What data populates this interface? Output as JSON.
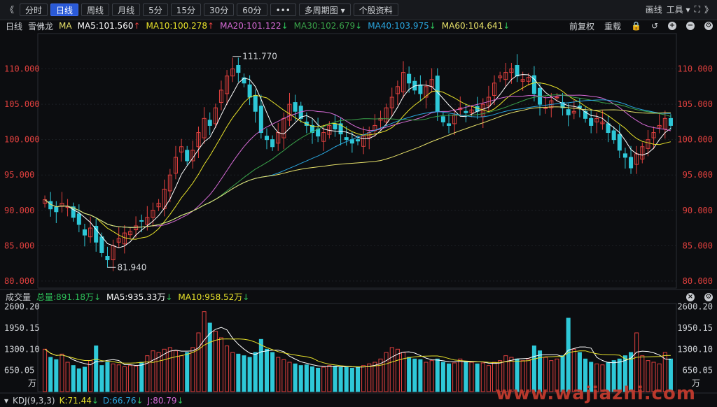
{
  "toolbar": {
    "back": "《",
    "periods": [
      "分时",
      "日线",
      "周线",
      "月线",
      "5分",
      "15分",
      "30分",
      "60分",
      "•••",
      "多周期图 ▾",
      "个股资料"
    ],
    "active_index": 1,
    "draw_label": "画线",
    "tools_label": "工具 ▾",
    "fullscreen": "⛶",
    "forward": "》"
  },
  "indicator": {
    "period": "日线",
    "stock_name": "雪佛龙",
    "ma_label": "MA",
    "ma5": "MA5:101.560",
    "ma10": "MA10:100.278",
    "ma20": "MA20:101.122",
    "ma30": "MA30:102.679",
    "ma40": "MA40:103.975",
    "ma60": "MA60:104.641",
    "ma5_dir": "↑",
    "ma10_dir": "↑",
    "ma20_dir": "↓",
    "ma30_dir": "↓",
    "ma40_dir": "↓",
    "ma60_dir": "↓",
    "adjust": "前复权",
    "redraw": "重载"
  },
  "colors": {
    "ma5": "#ffffff",
    "ma10": "#e8e22a",
    "ma20": "#d66bd6",
    "ma30": "#3aa34a",
    "ma40": "#2aa7e0",
    "ma60": "#e8e26a",
    "up": "#e0403e",
    "down": "#2ec8d8",
    "grid": "#2a2d33"
  },
  "price_axis": {
    "labels": [
      "110.000",
      "105.000",
      "100.000",
      "95.000",
      "90.000",
      "85.000",
      "80.000"
    ],
    "values": [
      110,
      105,
      100,
      95,
      90,
      85,
      80
    ],
    "high_label": "111.770",
    "low_label": "81.940"
  },
  "volume": {
    "title": "成交量",
    "total": "总量:891.18万",
    "ma5": "MA5:935.33万",
    "ma10": "MA10:958.52万",
    "total_dir": "↓",
    "ma5_dir": "↓",
    "ma10_dir": "↓",
    "axis_labels": [
      "2600.20",
      "1950.15",
      "1300.10",
      "650.05"
    ],
    "axis_values": [
      2600.2,
      1950.15,
      1300.1,
      650.05
    ],
    "unit": "万"
  },
  "kdj": {
    "name": "KDJ(9,3,3)",
    "k": "K:71.44",
    "d": "D:66.76",
    "j": "J:80.79",
    "k_dir": "↓",
    "d_dir": "↓",
    "j_dir": "↓"
  },
  "watermark": "www.wajiazhi.com",
  "chart_data": {
    "type": "candlestick",
    "ylim": [
      79,
      115
    ],
    "close": [
      91.5,
      90.2,
      89.8,
      91.0,
      90.5,
      89.0,
      88.0,
      86.5,
      87.5,
      85.5,
      84.0,
      83.0,
      85.0,
      86.0,
      86.8,
      87.0,
      87.8,
      88.5,
      89.0,
      90.0,
      91.0,
      93.0,
      95.0,
      97.5,
      99.0,
      97.0,
      98.5,
      101.0,
      103.0,
      102.0,
      104.5,
      107.0,
      109.0,
      110.0,
      109.5,
      108.0,
      106.0,
      104.0,
      101.0,
      100.0,
      99.0,
      101.0,
      103.0,
      105.0,
      104.0,
      103.0,
      102.0,
      101.0,
      100.5,
      101.0,
      102.0,
      101.5,
      100.8,
      100.0,
      99.5,
      99.8,
      100.5,
      101.0,
      102.0,
      103.0,
      104.5,
      106.0,
      107.5,
      109.5,
      108.0,
      107.0,
      106.5,
      107.5,
      108.5,
      104.0,
      102.5,
      102.0,
      103.5,
      104.5,
      103.8,
      104.2,
      104.0,
      105.0,
      106.0,
      108.0,
      109.0,
      109.5,
      110.0,
      109.0,
      108.5,
      108.8,
      106.5,
      105.0,
      104.5,
      105.5,
      106.0,
      104.5,
      103.5,
      104.0,
      104.5,
      103.0,
      102.0,
      103.0,
      102.5,
      101.0,
      100.0,
      98.5,
      97.5,
      96.0,
      98.0,
      99.0,
      100.0,
      101.0,
      102.0,
      103.0,
      102.0
    ],
    "volume": [
      1300,
      1050,
      980,
      1150,
      900,
      800,
      700,
      750,
      950,
      1400,
      800,
      900,
      850,
      820,
      760,
      800,
      780,
      900,
      1100,
      1250,
      1200,
      1300,
      1350,
      1250,
      1100,
      1200,
      1350,
      1800,
      2450,
      2100,
      1850,
      1650,
      1400,
      1200,
      1150,
      1100,
      1050,
      1200,
      1600,
      1300,
      1200,
      1050,
      980,
      900,
      850,
      800,
      820,
      760,
      720,
      750,
      800,
      780,
      760,
      740,
      720,
      760,
      800,
      850,
      900,
      1000,
      1200,
      1350,
      1300,
      1200,
      1050,
      1000,
      980,
      900,
      950,
      1000,
      900,
      850,
      880,
      1000,
      920,
      900,
      850,
      880,
      800,
      900,
      950,
      1100,
      1050,
      1000,
      950,
      1000,
      1400,
      1250,
      1050,
      950,
      1000,
      1100,
      2250,
      1300,
      1200,
      1000,
      900,
      850,
      820,
      900,
      950,
      1000,
      1100,
      1200,
      1800,
      1100,
      950,
      900,
      850,
      1200,
      1000
    ]
  }
}
